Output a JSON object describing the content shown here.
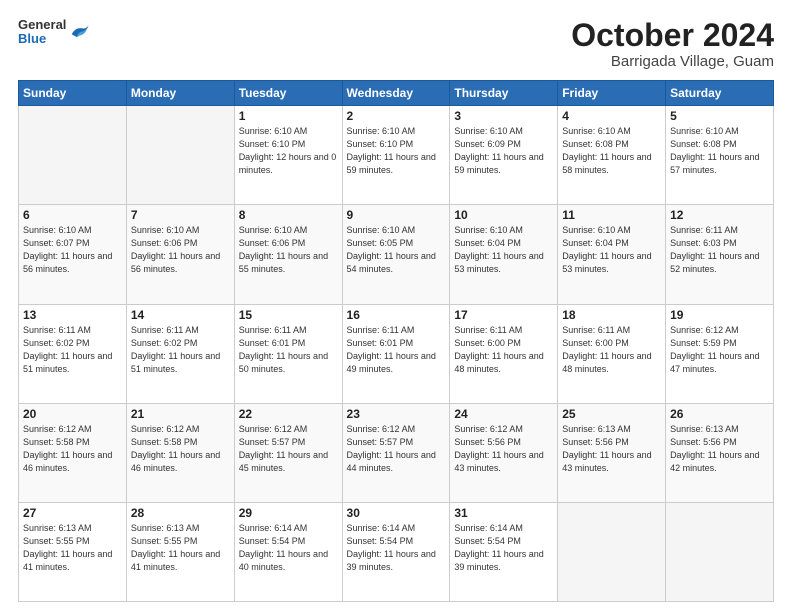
{
  "header": {
    "logo_general": "General",
    "logo_blue": "Blue",
    "month_title": "October 2024",
    "location": "Barrigada Village, Guam"
  },
  "days_of_week": [
    "Sunday",
    "Monday",
    "Tuesday",
    "Wednesday",
    "Thursday",
    "Friday",
    "Saturday"
  ],
  "weeks": [
    [
      {
        "day": "",
        "info": ""
      },
      {
        "day": "",
        "info": ""
      },
      {
        "day": "1",
        "info": "Sunrise: 6:10 AM\nSunset: 6:10 PM\nDaylight: 12 hours\nand 0 minutes."
      },
      {
        "day": "2",
        "info": "Sunrise: 6:10 AM\nSunset: 6:10 PM\nDaylight: 11 hours\nand 59 minutes."
      },
      {
        "day": "3",
        "info": "Sunrise: 6:10 AM\nSunset: 6:09 PM\nDaylight: 11 hours\nand 59 minutes."
      },
      {
        "day": "4",
        "info": "Sunrise: 6:10 AM\nSunset: 6:08 PM\nDaylight: 11 hours\nand 58 minutes."
      },
      {
        "day": "5",
        "info": "Sunrise: 6:10 AM\nSunset: 6:08 PM\nDaylight: 11 hours\nand 57 minutes."
      }
    ],
    [
      {
        "day": "6",
        "info": "Sunrise: 6:10 AM\nSunset: 6:07 PM\nDaylight: 11 hours\nand 56 minutes."
      },
      {
        "day": "7",
        "info": "Sunrise: 6:10 AM\nSunset: 6:06 PM\nDaylight: 11 hours\nand 56 minutes."
      },
      {
        "day": "8",
        "info": "Sunrise: 6:10 AM\nSunset: 6:06 PM\nDaylight: 11 hours\nand 55 minutes."
      },
      {
        "day": "9",
        "info": "Sunrise: 6:10 AM\nSunset: 6:05 PM\nDaylight: 11 hours\nand 54 minutes."
      },
      {
        "day": "10",
        "info": "Sunrise: 6:10 AM\nSunset: 6:04 PM\nDaylight: 11 hours\nand 53 minutes."
      },
      {
        "day": "11",
        "info": "Sunrise: 6:10 AM\nSunset: 6:04 PM\nDaylight: 11 hours\nand 53 minutes."
      },
      {
        "day": "12",
        "info": "Sunrise: 6:11 AM\nSunset: 6:03 PM\nDaylight: 11 hours\nand 52 minutes."
      }
    ],
    [
      {
        "day": "13",
        "info": "Sunrise: 6:11 AM\nSunset: 6:02 PM\nDaylight: 11 hours\nand 51 minutes."
      },
      {
        "day": "14",
        "info": "Sunrise: 6:11 AM\nSunset: 6:02 PM\nDaylight: 11 hours\nand 51 minutes."
      },
      {
        "day": "15",
        "info": "Sunrise: 6:11 AM\nSunset: 6:01 PM\nDaylight: 11 hours\nand 50 minutes."
      },
      {
        "day": "16",
        "info": "Sunrise: 6:11 AM\nSunset: 6:01 PM\nDaylight: 11 hours\nand 49 minutes."
      },
      {
        "day": "17",
        "info": "Sunrise: 6:11 AM\nSunset: 6:00 PM\nDaylight: 11 hours\nand 48 minutes."
      },
      {
        "day": "18",
        "info": "Sunrise: 6:11 AM\nSunset: 6:00 PM\nDaylight: 11 hours\nand 48 minutes."
      },
      {
        "day": "19",
        "info": "Sunrise: 6:12 AM\nSunset: 5:59 PM\nDaylight: 11 hours\nand 47 minutes."
      }
    ],
    [
      {
        "day": "20",
        "info": "Sunrise: 6:12 AM\nSunset: 5:58 PM\nDaylight: 11 hours\nand 46 minutes."
      },
      {
        "day": "21",
        "info": "Sunrise: 6:12 AM\nSunset: 5:58 PM\nDaylight: 11 hours\nand 46 minutes."
      },
      {
        "day": "22",
        "info": "Sunrise: 6:12 AM\nSunset: 5:57 PM\nDaylight: 11 hours\nand 45 minutes."
      },
      {
        "day": "23",
        "info": "Sunrise: 6:12 AM\nSunset: 5:57 PM\nDaylight: 11 hours\nand 44 minutes."
      },
      {
        "day": "24",
        "info": "Sunrise: 6:12 AM\nSunset: 5:56 PM\nDaylight: 11 hours\nand 43 minutes."
      },
      {
        "day": "25",
        "info": "Sunrise: 6:13 AM\nSunset: 5:56 PM\nDaylight: 11 hours\nand 43 minutes."
      },
      {
        "day": "26",
        "info": "Sunrise: 6:13 AM\nSunset: 5:56 PM\nDaylight: 11 hours\nand 42 minutes."
      }
    ],
    [
      {
        "day": "27",
        "info": "Sunrise: 6:13 AM\nSunset: 5:55 PM\nDaylight: 11 hours\nand 41 minutes."
      },
      {
        "day": "28",
        "info": "Sunrise: 6:13 AM\nSunset: 5:55 PM\nDaylight: 11 hours\nand 41 minutes."
      },
      {
        "day": "29",
        "info": "Sunrise: 6:14 AM\nSunset: 5:54 PM\nDaylight: 11 hours\nand 40 minutes."
      },
      {
        "day": "30",
        "info": "Sunrise: 6:14 AM\nSunset: 5:54 PM\nDaylight: 11 hours\nand 39 minutes."
      },
      {
        "day": "31",
        "info": "Sunrise: 6:14 AM\nSunset: 5:54 PM\nDaylight: 11 hours\nand 39 minutes."
      },
      {
        "day": "",
        "info": ""
      },
      {
        "day": "",
        "info": ""
      }
    ]
  ]
}
